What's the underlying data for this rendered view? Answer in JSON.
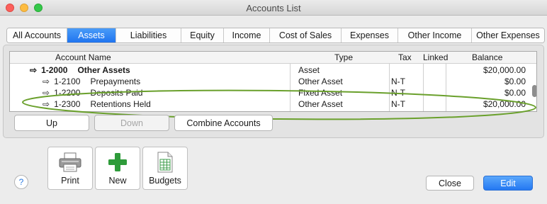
{
  "window": {
    "title": "Accounts List"
  },
  "tabs": [
    {
      "label": "All Accounts",
      "active": false
    },
    {
      "label": "Assets",
      "active": true
    },
    {
      "label": "Liabilities",
      "active": false
    },
    {
      "label": "Equity",
      "active": false
    },
    {
      "label": "Income",
      "active": false
    },
    {
      "label": "Cost of Sales",
      "active": false
    },
    {
      "label": "Expenses",
      "active": false
    },
    {
      "label": "Other Income",
      "active": false
    },
    {
      "label": "Other Expenses",
      "active": false
    }
  ],
  "table": {
    "columns": {
      "account_name": "Account Name",
      "type": "Type",
      "tax": "Tax",
      "linked": "Linked",
      "balance": "Balance"
    },
    "rows": [
      {
        "number": "1-2000",
        "name": "Other Assets",
        "type": "Asset",
        "tax": "",
        "linked": "",
        "balance": "$20,000.00",
        "header": true
      },
      {
        "number": "1-2100",
        "name": "Prepayments",
        "type": "Other Asset",
        "tax": "N-T",
        "linked": "",
        "balance": "$0.00",
        "header": false
      },
      {
        "number": "1-2200",
        "name": "Deposits Paid",
        "type": "Fixed Asset",
        "tax": "N-T",
        "linked": "",
        "balance": "$0.00",
        "header": false
      },
      {
        "number": "1-2300",
        "name": "Retentions Held",
        "type": "Other Asset",
        "tax": "N-T",
        "linked": "",
        "balance": "$20,000.00",
        "header": false
      }
    ]
  },
  "buttons": {
    "up": "Up",
    "down": "Down",
    "combine": "Combine Accounts",
    "print": "Print",
    "new": "New",
    "budgets": "Budgets",
    "close": "Close",
    "edit": "Edit",
    "help": "?"
  },
  "colors": {
    "accent": "#1f74ef",
    "highlight_ellipse": "#6aa02c",
    "new_icon": "#2e9b3a"
  },
  "icons": {
    "row_arrow": "right-arrow-icon",
    "print": "printer-icon",
    "new": "plus-icon",
    "budgets": "spreadsheet-icon",
    "help": "question-icon"
  }
}
